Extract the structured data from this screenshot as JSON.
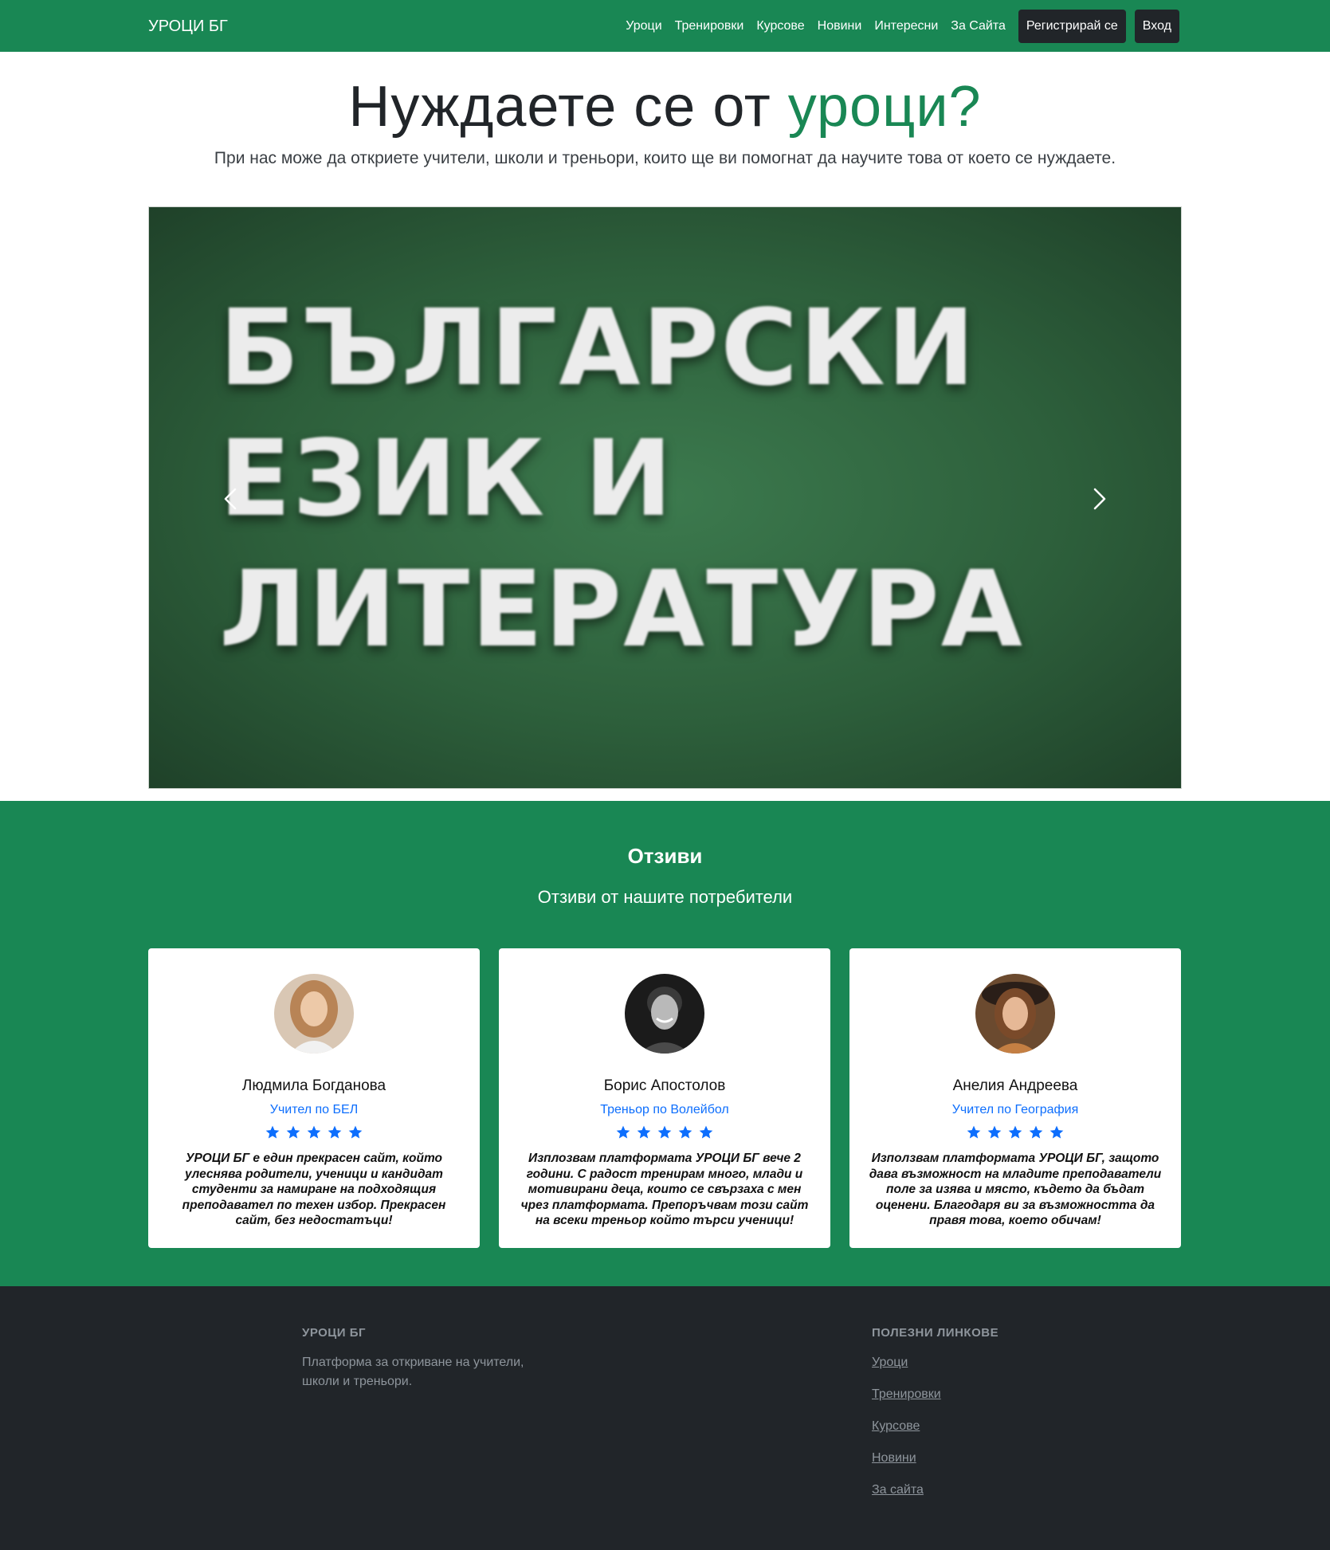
{
  "navbar": {
    "brand": "УРОЦИ БГ",
    "links": [
      "Уроци",
      "Тренировки",
      "Курсове",
      "Новини",
      "Интересни",
      "За Сайта"
    ],
    "register_label": "Регистрирай се",
    "login_label": "Вход"
  },
  "hero": {
    "title_prefix": "Нуждаете се от",
    "title_accent": "уроци?",
    "subtitle": "При нас може да откриете учители, школи и треньори, които ще ви помогнат да научите това от което се нуждаете."
  },
  "carousel": {
    "slide_lines": [
      "БЪЛГАРСКИ",
      "ЕЗИК И",
      "ЛИТЕРАТУРА"
    ],
    "prev_icon": "chevron-left-icon",
    "next_icon": "chevron-right-icon"
  },
  "testimonials": {
    "title": "Отзиви",
    "subtitle": "Отзиви от нашите потребители",
    "cards": [
      {
        "name": "Людмила Богданова",
        "role": "Учител по БЕЛ",
        "rating": 5,
        "text": "УРОЦИ БГ е един прекрасен сайт, който улеснява родители, ученици и кандидат студенти за намиране на подходящия преподавател по техен избор. Прекрасен сайт, без недостатъци!"
      },
      {
        "name": "Борис Апостолов",
        "role": "Треньор по Волейбол",
        "rating": 5,
        "text": "Изплозвам платформата УРОЦИ БГ вече 2 години. С радост тренирам много, млади и мотивирани деца, които се свързаха с мен чрез платформата. Препоръчвам този сайт на всеки треньор който търси ученици!"
      },
      {
        "name": "Анелия Андреева",
        "role": "Учител по География",
        "rating": 5,
        "text": "Използвам платформата УРОЦИ БГ, защото дава възможност на младите преподаватели поле за изява и място, където да бъдат оценени. Благодаря ви за възможността да правя това, което обичам!"
      }
    ]
  },
  "footer": {
    "brand_heading": "УРОЦИ БГ",
    "description": "Платформа за откриване на учители, школи и треньори.",
    "links_heading": "ПОЛЕЗНИ ЛИНКОВЕ",
    "links": [
      "Уроци",
      "Тренировки",
      "Курсове",
      "Новини",
      "За сайта"
    ]
  },
  "colors": {
    "brand_green": "#198754",
    "dark": "#212529",
    "accent_blue": "#0d6efd"
  }
}
